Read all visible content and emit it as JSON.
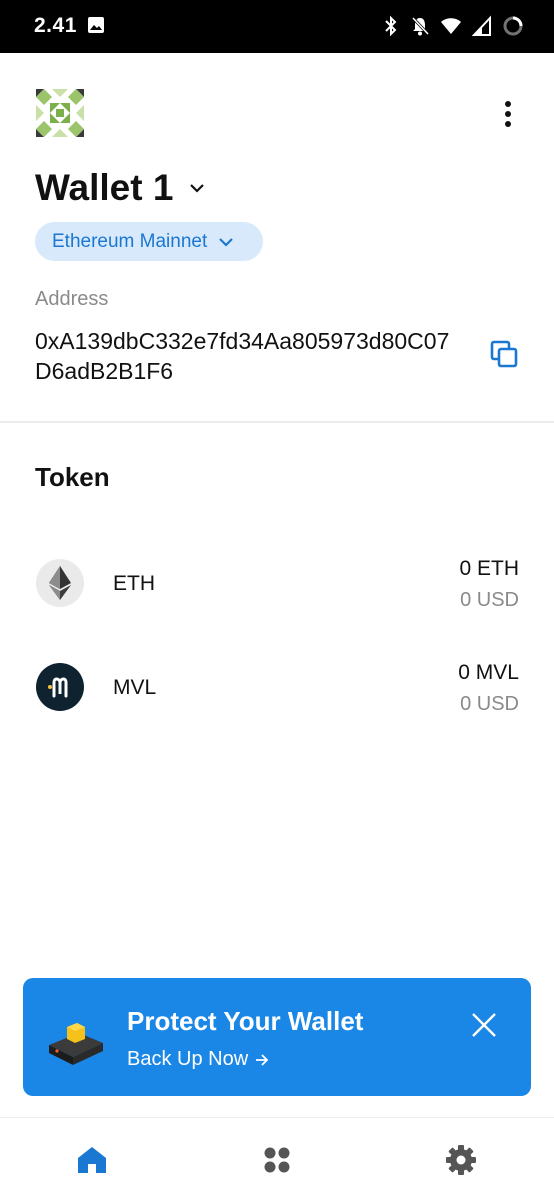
{
  "status_bar": {
    "time": "2.41"
  },
  "header": {
    "avatar_icon": "identicon",
    "more_icon": "more-vertical-icon"
  },
  "wallet": {
    "name": "Wallet 1",
    "network": "Ethereum Mainnet",
    "address_label": "Address",
    "address": "0xA139dbC332e7fd34Aa805973d80C07D6adB2B1F6"
  },
  "tokens_section": {
    "title": "Token",
    "items": [
      {
        "symbol": "ETH",
        "amount": "0 ETH",
        "fiat": "0 USD",
        "icon": "ethereum-icon"
      },
      {
        "symbol": "MVL",
        "amount": "0 MVL",
        "fiat": "0 USD",
        "icon": "mvl-icon"
      }
    ]
  },
  "backup_banner": {
    "title": "Protect Your Wallet",
    "link": "Back Up Now",
    "color": "#1a87e6"
  },
  "bottom_nav": {
    "items": [
      {
        "icon": "home-icon",
        "active": true
      },
      {
        "icon": "apps-icon",
        "active": false
      },
      {
        "icon": "settings-icon",
        "active": false
      }
    ]
  },
  "colors": {
    "accent": "#1a78d2",
    "pill_bg": "#d7e9fb",
    "muted_text": "#8a8a8a"
  }
}
